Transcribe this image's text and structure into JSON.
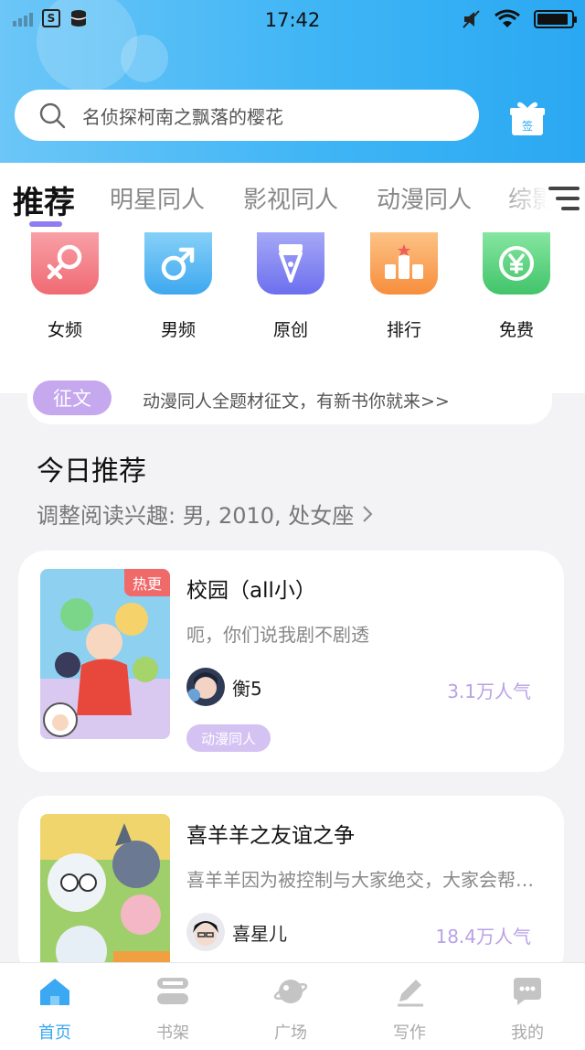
{
  "status_bar": {
    "time": "17:42",
    "sim_label": "S",
    "battery_level": 0.92
  },
  "search": {
    "placeholder": "名侦探柯南之飘落的樱花"
  },
  "gift_icon_label": "签",
  "tabs": [
    {
      "label": "推荐",
      "active": true
    },
    {
      "label": "明星同人"
    },
    {
      "label": "影视同人"
    },
    {
      "label": "动漫同人"
    },
    {
      "label": "综影"
    }
  ],
  "categories": [
    {
      "label": "女频",
      "icon": "female-icon",
      "color": "#f2787f"
    },
    {
      "label": "男频",
      "icon": "male-icon",
      "color": "#4fb4f0"
    },
    {
      "label": "原创",
      "icon": "pen-icon",
      "color": "#7f84f0"
    },
    {
      "label": "排行",
      "icon": "podium-icon",
      "color": "#f9a14f"
    },
    {
      "label": "免费",
      "icon": "yen-icon",
      "color": "#57d27a"
    }
  ],
  "banner": {
    "tag": "征文",
    "text": "动漫同人全题材征文，有新书你就来>>"
  },
  "section": {
    "title": "今日推荐",
    "subtitle": "调整阅读兴趣: 男, 2010, 处女座"
  },
  "books": [
    {
      "title": "校园（all小）",
      "badge": "热更",
      "description": "呃，你们说我剧不剧透",
      "author": "衡5",
      "popularity": "3.1万人气",
      "tag": "动漫同人"
    },
    {
      "title": "喜羊羊之友谊之争",
      "description": "喜羊羊因为被控制与大家绝交，大家会帮助他吗",
      "author": "喜星儿",
      "popularity": "18.4万人气"
    }
  ],
  "bottom_nav": [
    {
      "label": "首页",
      "icon": "home-icon",
      "active": true
    },
    {
      "label": "书架",
      "icon": "bookshelf-icon"
    },
    {
      "label": "广场",
      "icon": "planet-icon"
    },
    {
      "label": "写作",
      "icon": "write-icon"
    },
    {
      "label": "我的",
      "icon": "chat-icon"
    }
  ],
  "colors": {
    "accent": "#8e7df2",
    "header_gradient_start": "#6cc6f7",
    "header_gradient_end": "#2aa8f2",
    "nav_active": "#3aa8f2"
  }
}
